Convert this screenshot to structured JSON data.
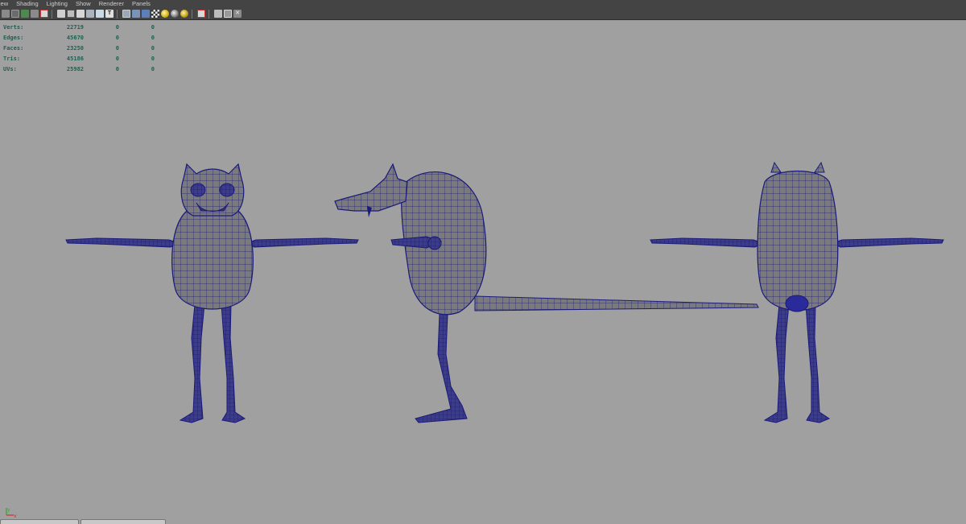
{
  "menubar": {
    "items": [
      "View",
      "Shading",
      "Lighting",
      "Show",
      "Renderer",
      "Panels"
    ]
  },
  "toolbar": {
    "groups": [
      [
        "camera-icon",
        "select-camera-icon",
        "bookmark-icon",
        "image-plane-icon",
        "grid-icon"
      ],
      [
        "film-gate-icon",
        "resolution-gate-icon",
        "gate-mask-icon",
        "field-chart-icon",
        "safe-action-icon",
        "safe-title-icon"
      ],
      [
        "wireframe-icon",
        "smooth-shade-icon",
        "wireframe-on-shaded-icon",
        "textured-icon",
        "use-lights-icon",
        "shadows-icon"
      ],
      [
        "isolate-select-icon",
        "xray-icon",
        "xray-joints-icon",
        "xray-components-icon"
      ]
    ],
    "colors": {
      "bar": "#444444",
      "viewport": "#a0a0a0",
      "hud_text": "#1e5f52",
      "wire": "#1a1a7a",
      "mesh_fill": "#7a7a7a"
    }
  },
  "hud": {
    "rows": [
      {
        "label": "Verts:",
        "c1": "22719",
        "c2": "0",
        "c3": "0"
      },
      {
        "label": "Edges:",
        "c1": "45670",
        "c2": "0",
        "c3": "0"
      },
      {
        "label": "Faces:",
        "c1": "23250",
        "c2": "0",
        "c3": "0"
      },
      {
        "label": "Tris:",
        "c1": "45186",
        "c2": "0",
        "c3": "0"
      },
      {
        "label": "UVs:",
        "c1": "25982",
        "c2": "0",
        "c3": "0"
      }
    ]
  },
  "axis": {
    "x_label": "x",
    "y_label": "y"
  },
  "viewport": {
    "models": [
      "front-view",
      "side-view",
      "back-view"
    ]
  }
}
